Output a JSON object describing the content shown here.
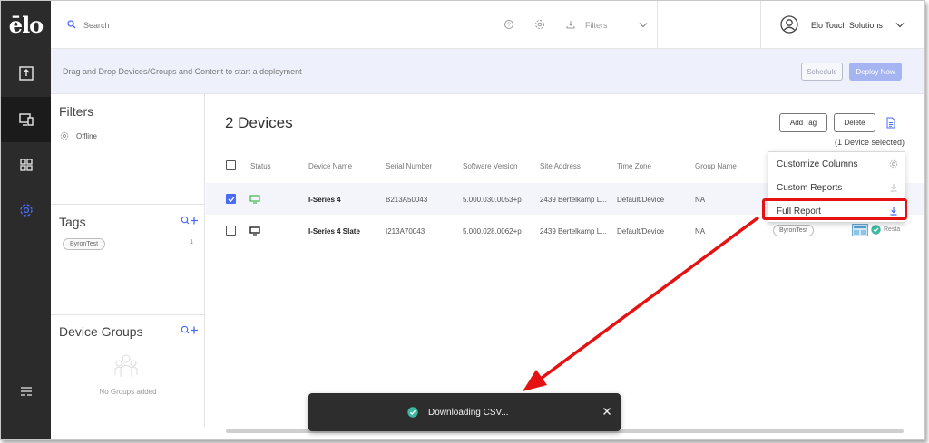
{
  "app": {
    "logo_text": "ēlo"
  },
  "topbar": {
    "search_placeholder": "Search",
    "filters_label": "Filters",
    "user_name": "Elo Touch Solutions"
  },
  "deploy": {
    "hint": "Drag and Drop Devices/Groups and Content to start a deployment",
    "schedule_label": "Schedule",
    "deploy_now_label": "Deploy Now"
  },
  "panel": {
    "filters_title": "Filters",
    "filter_items": [
      {
        "label": "Offline"
      }
    ],
    "tags_title": "Tags",
    "tags": [
      {
        "label": "ByronTest",
        "count": "1"
      }
    ],
    "groups_title": "Device Groups",
    "groups_empty": "No Groups added"
  },
  "main": {
    "title": "2 Devices",
    "add_tag_label": "Add Tag",
    "delete_label": "Delete",
    "selected_note": "(1 Device selected)",
    "columns": [
      "Status",
      "Device Name",
      "Serial Number",
      "Software Version",
      "Site Address",
      "Time Zone",
      "Group Name"
    ],
    "rows": [
      {
        "selected": true,
        "status_color": "#3cb84a",
        "device_name": "I-Series 4",
        "serial": "B213A50043",
        "software": "5.000.030.0053+p",
        "site": "2439 Bertelkamp L...",
        "timezone": "Default/Device",
        "group": "NA"
      },
      {
        "selected": false,
        "status_color": "#222222",
        "device_name": "I-Series 4 Slate",
        "serial": "I213A70043",
        "software": "5.000.028.0062+p",
        "site": "2439 Bertelkamp L...",
        "timezone": "Default/Device",
        "group": "NA",
        "tag": "ByronTest",
        "status_text": "Resta"
      }
    ]
  },
  "menu": {
    "items": [
      {
        "label": "Customize Columns",
        "icon": "gear-icon"
      },
      {
        "label": "Custom Reports",
        "icon": "download-icon"
      },
      {
        "label": "Full Report",
        "icon": "download-icon"
      }
    ]
  },
  "toast": {
    "text": "Downloading CSV..."
  },
  "colors": {
    "accent": "#4a6cf7",
    "highlight": "#e41212",
    "success": "#3bb8a0"
  }
}
